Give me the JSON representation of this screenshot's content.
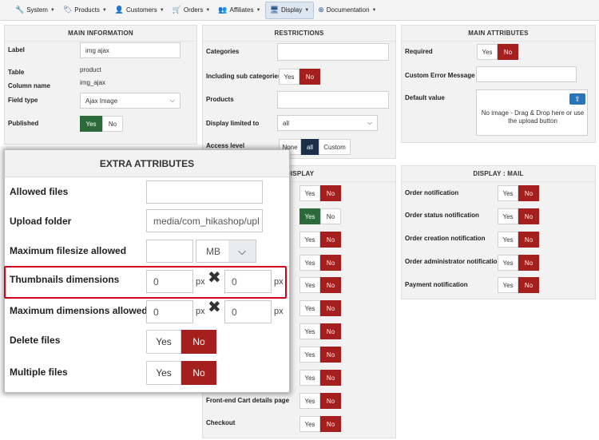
{
  "menu": [
    {
      "label": "System",
      "icon": "wrench-icon",
      "glyph": "🔧"
    },
    {
      "label": "Products",
      "icon": "tag-icon",
      "glyph": "🏷"
    },
    {
      "label": "Customers",
      "icon": "user-icon",
      "glyph": "👤"
    },
    {
      "label": "Orders",
      "icon": "cart-icon",
      "glyph": "🛒"
    },
    {
      "label": "Affiliates",
      "icon": "users-icon",
      "glyph": "👥"
    },
    {
      "label": "Display",
      "icon": "monitor-icon",
      "glyph": "🖥"
    },
    {
      "label": "Documentation",
      "icon": "help-icon",
      "glyph": "⊗"
    }
  ],
  "main_info": {
    "title": "MAIN INFORMATION",
    "label_lbl": "Label",
    "label_val": "img ajax",
    "table_lbl": "Table",
    "table_val": "product",
    "column_lbl": "Column name",
    "column_val": "img_ajax",
    "fieldtype_lbl": "Field type",
    "fieldtype_val": "Ajax Image",
    "published_lbl": "Published",
    "yes": "Yes",
    "no": "No"
  },
  "restrictions": {
    "title": "RESTRICTIONS",
    "categories_lbl": "Categories",
    "subcat_lbl": "Including sub categories",
    "products_lbl": "Products",
    "display_limited_lbl": "Display limited to",
    "display_limited_val": "all",
    "access_lbl": "Access level",
    "access_none": "None",
    "access_all": "all",
    "access_custom": "Custom",
    "yes": "Yes",
    "no": "No"
  },
  "main_attr": {
    "title": "MAIN ATTRIBUTES",
    "required_lbl": "Required",
    "custom_error_lbl": "Custom Error Message",
    "default_lbl": "Default value",
    "dropzone_text": "No image - Drag & Drop here or use the upload button",
    "yes": "Yes",
    "no": "No"
  },
  "display": {
    "title": "DISPLAY",
    "frontcart_lbl": "Front-end Cart details page",
    "checkout_lbl": "Checkout",
    "yes": "Yes",
    "no": "No"
  },
  "display_mail": {
    "title": "DISPLAY : MAIL",
    "rows": [
      "Order notification",
      "Order status notification",
      "Order creation notification",
      "Order administrator notification",
      "Payment notification"
    ],
    "yes": "Yes",
    "no": "No"
  },
  "extra": {
    "title": "EXTRA ATTRIBUTES",
    "allowed_lbl": "Allowed files",
    "upload_lbl": "Upload folder",
    "upload_val": "media/com_hikashop/upl",
    "maxsize_lbl": "Maximum filesize allowed",
    "maxsize_unit": "MB",
    "thumb_lbl": "Thumbnails dimensions",
    "thumb_w": "0",
    "thumb_h": "0",
    "maxdim_lbl": "Maximum dimensions allowed",
    "maxdim_w": "0",
    "maxdim_h": "0",
    "px": "px",
    "times": "✖",
    "delete_lbl": "Delete files",
    "multiple_lbl": "Multiple files",
    "yes": "Yes",
    "no": "No"
  }
}
